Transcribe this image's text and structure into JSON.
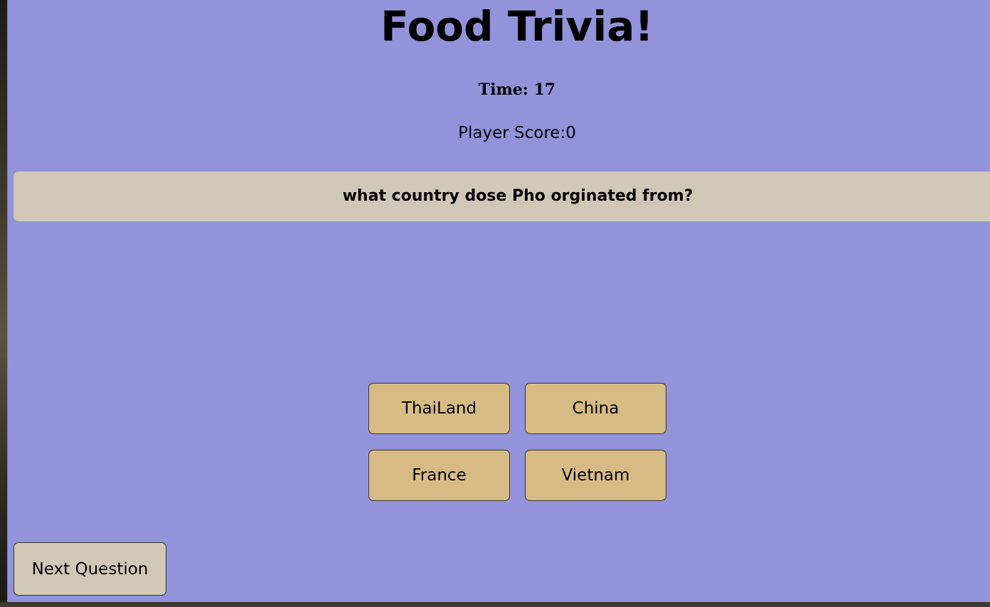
{
  "header": {
    "title": "Food Trivia!"
  },
  "status": {
    "timer_text": "Time: 17",
    "score_text": "Player Score:0"
  },
  "question": {
    "text": "what country dose Pho orginated from?"
  },
  "answers": [
    {
      "label": "ThaiLand"
    },
    {
      "label": "China"
    },
    {
      "label": "France"
    },
    {
      "label": "Vietnam"
    }
  ],
  "controls": {
    "next_label": "Next Question"
  },
  "colors": {
    "page_background": "#9293da",
    "question_background": "#d0c8b6",
    "answer_background": "#d7bb84",
    "next_background": "#d0c8b6"
  }
}
